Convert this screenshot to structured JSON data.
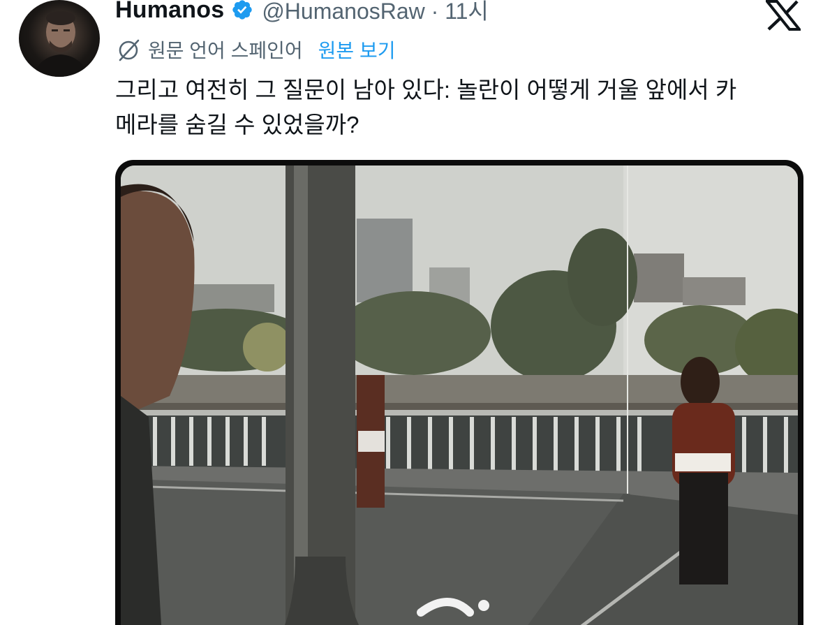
{
  "author": {
    "display_name": "Humanos",
    "handle": "@HumanosRaw",
    "separator": "·",
    "time": "11시",
    "verified_icon": "verified-badge-icon",
    "avatar_icon": "profile-photo"
  },
  "brand": {
    "logo": "x-logo-icon"
  },
  "translation": {
    "label": "원문 언어 스페인어",
    "show_original": "원본 보기",
    "icon": "translate-icon"
  },
  "tweet": {
    "text": "그리고 여전히 그 질문이 남아 있다: 놀란이 어떻게 거울 앞에서 카\n메라를 숨길 수 있었을까?"
  },
  "media": {
    "type": "video",
    "description_icon": "video-thumbnail"
  },
  "colors": {
    "text_primary": "#0f1419",
    "text_secondary": "#536471",
    "link": "#1d9bf0",
    "verified": "#1d9bf0"
  }
}
